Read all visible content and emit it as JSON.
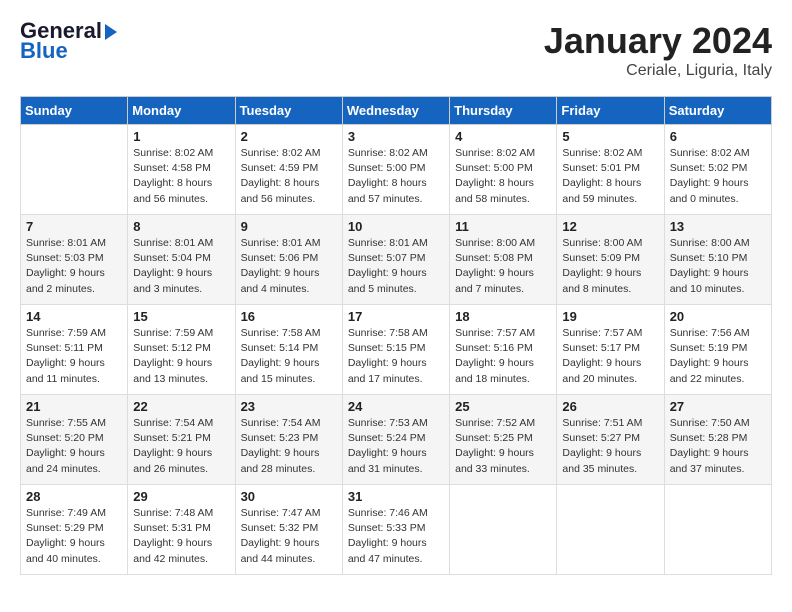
{
  "logo": {
    "general": "General",
    "blue": "Blue"
  },
  "title": "January 2024",
  "location": "Ceriale, Liguria, Italy",
  "headers": [
    "Sunday",
    "Monday",
    "Tuesday",
    "Wednesday",
    "Thursday",
    "Friday",
    "Saturday"
  ],
  "weeks": [
    [
      {
        "day": "",
        "sunrise": "",
        "sunset": "",
        "daylight": ""
      },
      {
        "day": "1",
        "sunrise": "Sunrise: 8:02 AM",
        "sunset": "Sunset: 4:58 PM",
        "daylight": "Daylight: 8 hours and 56 minutes."
      },
      {
        "day": "2",
        "sunrise": "Sunrise: 8:02 AM",
        "sunset": "Sunset: 4:59 PM",
        "daylight": "Daylight: 8 hours and 56 minutes."
      },
      {
        "day": "3",
        "sunrise": "Sunrise: 8:02 AM",
        "sunset": "Sunset: 5:00 PM",
        "daylight": "Daylight: 8 hours and 57 minutes."
      },
      {
        "day": "4",
        "sunrise": "Sunrise: 8:02 AM",
        "sunset": "Sunset: 5:00 PM",
        "daylight": "Daylight: 8 hours and 58 minutes."
      },
      {
        "day": "5",
        "sunrise": "Sunrise: 8:02 AM",
        "sunset": "Sunset: 5:01 PM",
        "daylight": "Daylight: 8 hours and 59 minutes."
      },
      {
        "day": "6",
        "sunrise": "Sunrise: 8:02 AM",
        "sunset": "Sunset: 5:02 PM",
        "daylight": "Daylight: 9 hours and 0 minutes."
      }
    ],
    [
      {
        "day": "7",
        "sunrise": "Sunrise: 8:01 AM",
        "sunset": "Sunset: 5:03 PM",
        "daylight": "Daylight: 9 hours and 2 minutes."
      },
      {
        "day": "8",
        "sunrise": "Sunrise: 8:01 AM",
        "sunset": "Sunset: 5:04 PM",
        "daylight": "Daylight: 9 hours and 3 minutes."
      },
      {
        "day": "9",
        "sunrise": "Sunrise: 8:01 AM",
        "sunset": "Sunset: 5:06 PM",
        "daylight": "Daylight: 9 hours and 4 minutes."
      },
      {
        "day": "10",
        "sunrise": "Sunrise: 8:01 AM",
        "sunset": "Sunset: 5:07 PM",
        "daylight": "Daylight: 9 hours and 5 minutes."
      },
      {
        "day": "11",
        "sunrise": "Sunrise: 8:00 AM",
        "sunset": "Sunset: 5:08 PM",
        "daylight": "Daylight: 9 hours and 7 minutes."
      },
      {
        "day": "12",
        "sunrise": "Sunrise: 8:00 AM",
        "sunset": "Sunset: 5:09 PM",
        "daylight": "Daylight: 9 hours and 8 minutes."
      },
      {
        "day": "13",
        "sunrise": "Sunrise: 8:00 AM",
        "sunset": "Sunset: 5:10 PM",
        "daylight": "Daylight: 9 hours and 10 minutes."
      }
    ],
    [
      {
        "day": "14",
        "sunrise": "Sunrise: 7:59 AM",
        "sunset": "Sunset: 5:11 PM",
        "daylight": "Daylight: 9 hours and 11 minutes."
      },
      {
        "day": "15",
        "sunrise": "Sunrise: 7:59 AM",
        "sunset": "Sunset: 5:12 PM",
        "daylight": "Daylight: 9 hours and 13 minutes."
      },
      {
        "day": "16",
        "sunrise": "Sunrise: 7:58 AM",
        "sunset": "Sunset: 5:14 PM",
        "daylight": "Daylight: 9 hours and 15 minutes."
      },
      {
        "day": "17",
        "sunrise": "Sunrise: 7:58 AM",
        "sunset": "Sunset: 5:15 PM",
        "daylight": "Daylight: 9 hours and 17 minutes."
      },
      {
        "day": "18",
        "sunrise": "Sunrise: 7:57 AM",
        "sunset": "Sunset: 5:16 PM",
        "daylight": "Daylight: 9 hours and 18 minutes."
      },
      {
        "day": "19",
        "sunrise": "Sunrise: 7:57 AM",
        "sunset": "Sunset: 5:17 PM",
        "daylight": "Daylight: 9 hours and 20 minutes."
      },
      {
        "day": "20",
        "sunrise": "Sunrise: 7:56 AM",
        "sunset": "Sunset: 5:19 PM",
        "daylight": "Daylight: 9 hours and 22 minutes."
      }
    ],
    [
      {
        "day": "21",
        "sunrise": "Sunrise: 7:55 AM",
        "sunset": "Sunset: 5:20 PM",
        "daylight": "Daylight: 9 hours and 24 minutes."
      },
      {
        "day": "22",
        "sunrise": "Sunrise: 7:54 AM",
        "sunset": "Sunset: 5:21 PM",
        "daylight": "Daylight: 9 hours and 26 minutes."
      },
      {
        "day": "23",
        "sunrise": "Sunrise: 7:54 AM",
        "sunset": "Sunset: 5:23 PM",
        "daylight": "Daylight: 9 hours and 28 minutes."
      },
      {
        "day": "24",
        "sunrise": "Sunrise: 7:53 AM",
        "sunset": "Sunset: 5:24 PM",
        "daylight": "Daylight: 9 hours and 31 minutes."
      },
      {
        "day": "25",
        "sunrise": "Sunrise: 7:52 AM",
        "sunset": "Sunset: 5:25 PM",
        "daylight": "Daylight: 9 hours and 33 minutes."
      },
      {
        "day": "26",
        "sunrise": "Sunrise: 7:51 AM",
        "sunset": "Sunset: 5:27 PM",
        "daylight": "Daylight: 9 hours and 35 minutes."
      },
      {
        "day": "27",
        "sunrise": "Sunrise: 7:50 AM",
        "sunset": "Sunset: 5:28 PM",
        "daylight": "Daylight: 9 hours and 37 minutes."
      }
    ],
    [
      {
        "day": "28",
        "sunrise": "Sunrise: 7:49 AM",
        "sunset": "Sunset: 5:29 PM",
        "daylight": "Daylight: 9 hours and 40 minutes."
      },
      {
        "day": "29",
        "sunrise": "Sunrise: 7:48 AM",
        "sunset": "Sunset: 5:31 PM",
        "daylight": "Daylight: 9 hours and 42 minutes."
      },
      {
        "day": "30",
        "sunrise": "Sunrise: 7:47 AM",
        "sunset": "Sunset: 5:32 PM",
        "daylight": "Daylight: 9 hours and 44 minutes."
      },
      {
        "day": "31",
        "sunrise": "Sunrise: 7:46 AM",
        "sunset": "Sunset: 5:33 PM",
        "daylight": "Daylight: 9 hours and 47 minutes."
      },
      {
        "day": "",
        "sunrise": "",
        "sunset": "",
        "daylight": ""
      },
      {
        "day": "",
        "sunrise": "",
        "sunset": "",
        "daylight": ""
      },
      {
        "day": "",
        "sunrise": "",
        "sunset": "",
        "daylight": ""
      }
    ]
  ]
}
